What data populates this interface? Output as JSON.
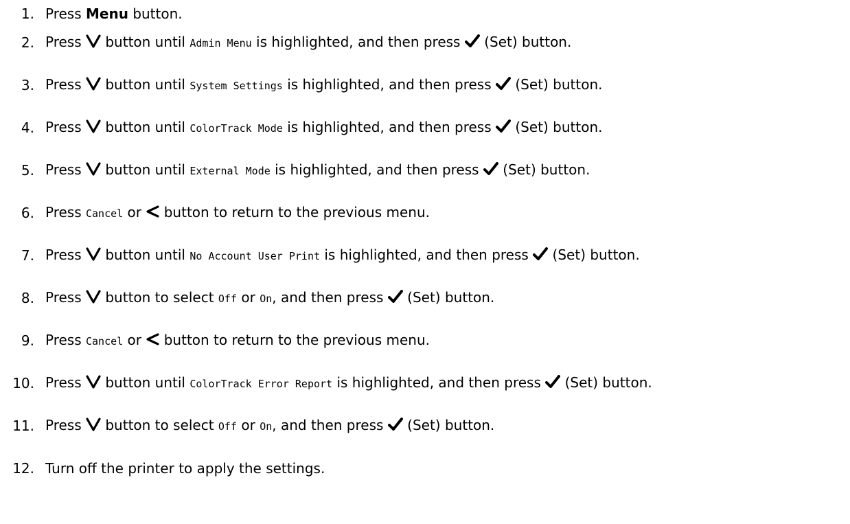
{
  "words": {
    "press": "Press",
    "button": "button",
    "button_until": "button until",
    "button_to_select": "button to select",
    "is_highlighted_then_press": "is highlighted, and then press",
    "or": "or",
    "comma_then_press": ", and then press",
    "set_button": "(Set) button.",
    "button_to_return": "button to return to the previous menu."
  },
  "steps": [
    {
      "num": "1.",
      "menu_label": "Menu",
      "button_text": "button."
    },
    {
      "num": "2.",
      "item": "Admin Menu"
    },
    {
      "num": "3.",
      "item": "System Settings"
    },
    {
      "num": "4.",
      "item": "ColorTrack Mode"
    },
    {
      "num": "5.",
      "item": "External Mode"
    },
    {
      "num": "6.",
      "cancel": "Cancel"
    },
    {
      "num": "7.",
      "item": "No Account User Print"
    },
    {
      "num": "8.",
      "opt1": "Off",
      "opt2": "On"
    },
    {
      "num": "9.",
      "cancel": "Cancel"
    },
    {
      "num": "10.",
      "item": "ColorTrack Error Report"
    },
    {
      "num": "11.",
      "opt1": "Off",
      "opt2": "On"
    },
    {
      "num": "12.",
      "text": "Turn off the printer to apply the settings."
    }
  ],
  "icons": {
    "down": "chevron-down-icon",
    "set": "checkmark-icon",
    "back": "chevron-left-icon"
  }
}
